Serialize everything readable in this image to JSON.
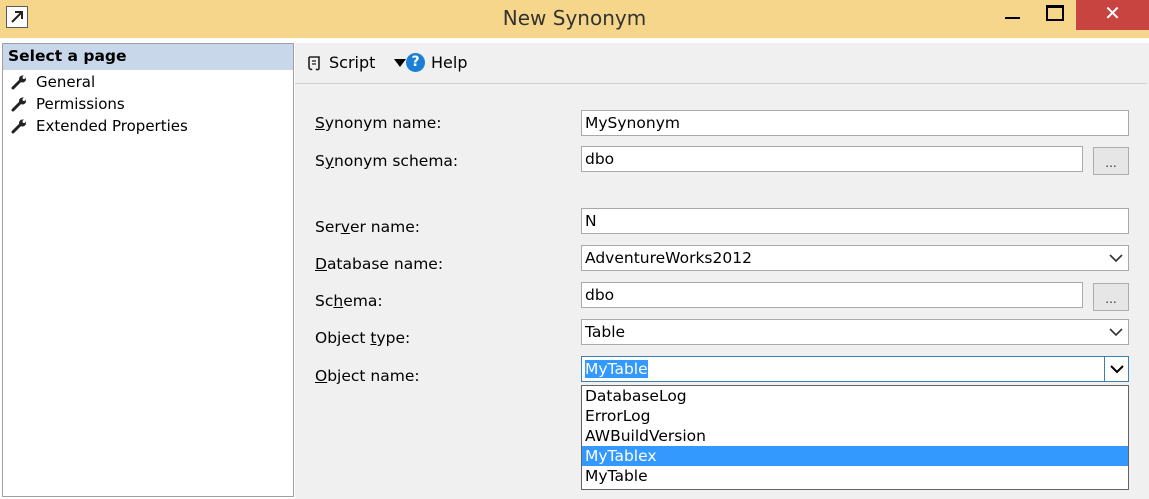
{
  "window": {
    "title": "New Synonym",
    "close_glyph": "✕"
  },
  "left_pane": {
    "header": "Select a page",
    "items": [
      {
        "label": "General",
        "icon": "wrench-icon"
      },
      {
        "label": "Permissions",
        "icon": "wrench-icon"
      },
      {
        "label": "Extended Properties",
        "icon": "wrench-icon"
      }
    ]
  },
  "toolbar": {
    "script_label": "Script",
    "help_label": "Help",
    "help_glyph": "?"
  },
  "form": {
    "synonym_name": {
      "pre": "",
      "mnemonic": "S",
      "post": "ynonym name:",
      "value": "MySynonym"
    },
    "synonym_schema": {
      "pre": "S",
      "mnemonic": "y",
      "post": "nonym schema:",
      "value": "dbo",
      "browse": "..."
    },
    "server_name": {
      "pre": "Ser",
      "mnemonic": "v",
      "post": "er name:",
      "value": "N"
    },
    "database_name": {
      "pre": "",
      "mnemonic": "D",
      "post": "atabase name:",
      "value": "AdventureWorks2012"
    },
    "schema": {
      "pre": "Sc",
      "mnemonic": "h",
      "post": "ema:",
      "value": "dbo",
      "browse": "..."
    },
    "object_type": {
      "pre": "Object ",
      "mnemonic": "t",
      "post": "ype:",
      "value": "Table"
    },
    "object_name": {
      "pre": "",
      "mnemonic": "O",
      "post": "bject name:",
      "value": "MyTable"
    }
  },
  "object_name_options": [
    "DatabaseLog",
    "ErrorLog",
    "AWBuildVersion",
    "MyTablex",
    "MyTable"
  ],
  "highlighted_option_index": 3,
  "colors": {
    "titlebar": "#f6d68a",
    "close_button": "#c74440",
    "selection": "#3399ff",
    "left_header": "#c8d7ea"
  }
}
